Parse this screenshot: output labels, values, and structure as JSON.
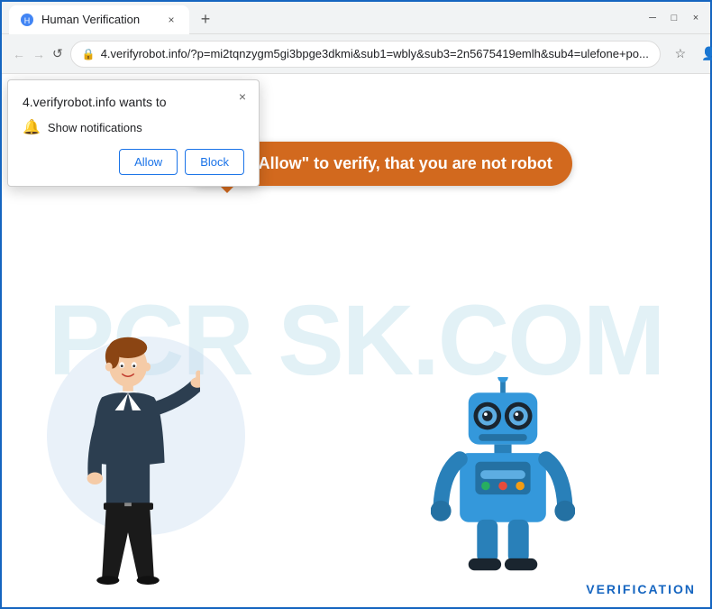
{
  "browser": {
    "title_bar": {
      "tab_title": "Human Verification",
      "close_label": "×",
      "minimize_label": "─",
      "maximize_label": "□",
      "new_tab_label": "+"
    },
    "address_bar": {
      "url": "4.verifyrobot.info/?p=mi2tqnzygm5gi3bpge3dkmi&sub1=wbly&sub3=2n5675419emlh&sub4=ulefone+po...",
      "lock_icon": "🔒",
      "back_icon": "←",
      "forward_icon": "→",
      "reload_icon": "↺",
      "star_icon": "☆",
      "account_icon": "👤",
      "menu_icon": "⋮"
    }
  },
  "notification_popup": {
    "title": "4.verifyrobot.info wants to",
    "close_icon": "×",
    "bell_icon": "🔔",
    "notification_text": "Show notifications",
    "allow_button": "Allow",
    "block_button": "Block"
  },
  "page_content": {
    "speech_bubble_text": "Press \"Allow\" to verify, that you are not robot",
    "watermark_text": "PCR SK.COM",
    "verification_label": "VERIFICATION",
    "circle_bg_color": "#c8d8f0"
  },
  "colors": {
    "browser_blue": "#1565C0",
    "bubble_color": "#d2691e",
    "allow_color": "#1a73e8",
    "block_color": "#1a73e8"
  }
}
